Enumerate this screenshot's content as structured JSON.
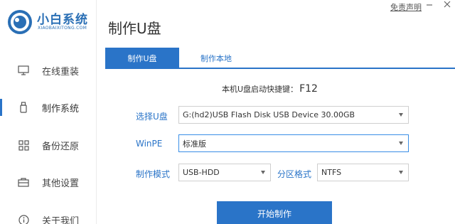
{
  "app": {
    "logo_text": "小白系统",
    "logo_sub": "XIAOBAIXITONG.COM",
    "page_title": "制作U盘",
    "top_link": "免责声明"
  },
  "sidebar": {
    "items": [
      {
        "label": "在线重装",
        "icon": "monitor-icon"
      },
      {
        "label": "制作系统",
        "icon": "usb-drive-icon"
      },
      {
        "label": "备份还原",
        "icon": "grid-icon"
      },
      {
        "label": "其他设置",
        "icon": "toolbox-icon"
      },
      {
        "label": "关于我们",
        "icon": "info-icon"
      }
    ],
    "active_index": 1
  },
  "tabs": [
    {
      "label": "制作U盘",
      "active": true
    },
    {
      "label": "制作本地",
      "active": false
    }
  ],
  "hotkey": {
    "label": "本机U盘启动快捷键：",
    "key": "F12"
  },
  "form": {
    "usb_label": "选择U盘",
    "usb_value": "G:(hd2)USB Flash Disk USB Device 30.00GB",
    "winpe_label": "WinPE",
    "winpe_value": "标准版",
    "mode_label": "制作模式",
    "mode_value": "USB-HDD",
    "partition_label": "分区格式",
    "partition_value": "NTFS"
  },
  "actions": {
    "start_label": "开始制作"
  },
  "colors": {
    "accent": "#2a74c8",
    "logo": "#2a6fb5"
  }
}
